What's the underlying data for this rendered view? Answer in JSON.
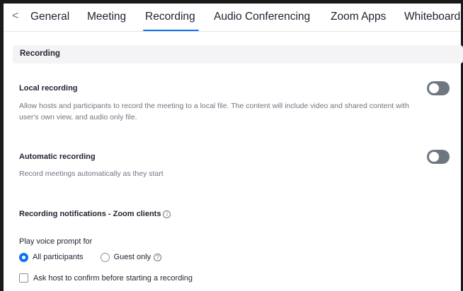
{
  "tabs": {
    "back_glyph": "<",
    "items": [
      {
        "label": "General"
      },
      {
        "label": "Meeting"
      },
      {
        "label": "Recording"
      },
      {
        "label": "Audio Conferencing"
      },
      {
        "label": "Zoom Apps"
      },
      {
        "label": "Whiteboard"
      }
    ],
    "active": "Recording"
  },
  "section": {
    "title": "Recording"
  },
  "local_recording": {
    "title": "Local recording",
    "description": "Allow hosts and participants to record the meeting to a local file. The content will include video and shared content with user's own view, and audio only file.",
    "enabled": false
  },
  "automatic_recording": {
    "title": "Automatic recording",
    "description": "Record meetings automatically as they start",
    "enabled": false
  },
  "notifications": {
    "title": "Recording notifications - Zoom clients",
    "info_glyph": "i",
    "play_prompt_label": "Play voice prompt for",
    "options": [
      {
        "label": "All participants",
        "selected": true
      },
      {
        "label": "Guest only",
        "selected": false
      }
    ],
    "help_glyph": "?",
    "confirm_checkbox": {
      "label": "Ask host to confirm before starting a recording",
      "checked": false
    }
  },
  "colors": {
    "accent": "#0e72ed",
    "toggle_off": "#6e7680",
    "header_bg": "#f4f4f6"
  }
}
